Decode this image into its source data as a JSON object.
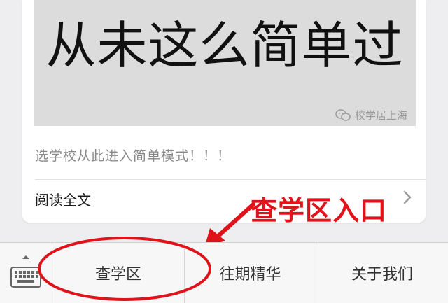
{
  "article": {
    "cover_text": "从未这么简单过",
    "watermark": "校学居上海",
    "digest": "选学校从此进入简单模式！！！",
    "read_more": "阅读全文"
  },
  "annotation": {
    "label": "查学区入口",
    "color": "#e0131a"
  },
  "menu": {
    "items": [
      {
        "label": "查学区"
      },
      {
        "label": "往期精华"
      },
      {
        "label": "关于我们"
      }
    ]
  },
  "icons": [
    "wechat-icon",
    "chevron-right-icon",
    "keyboard-icon",
    "expand-caret-icon"
  ]
}
